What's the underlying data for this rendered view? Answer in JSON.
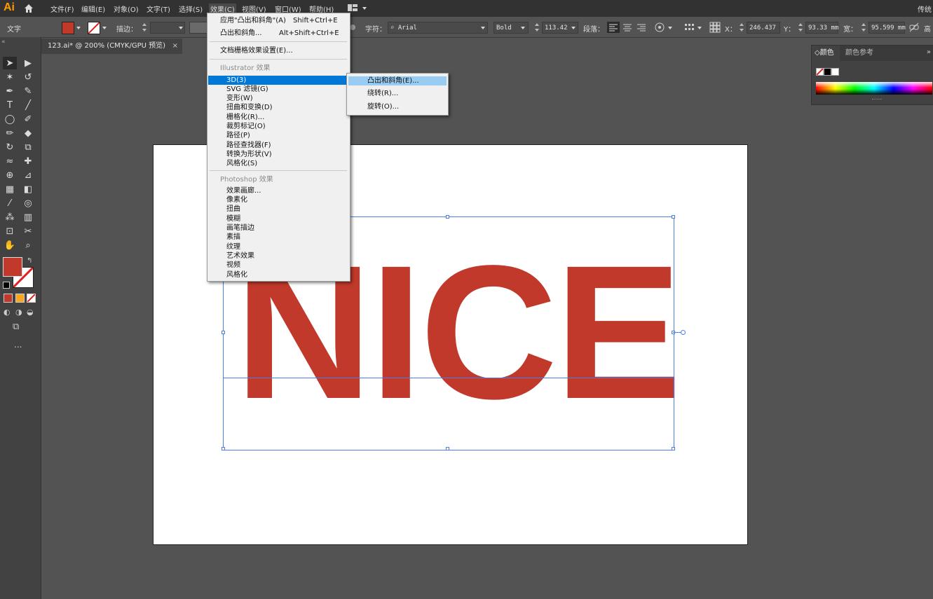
{
  "app": {
    "logo": "Ai",
    "menus": [
      "文件(F)",
      "编辑(E)",
      "对象(O)",
      "文字(T)",
      "选择(S)",
      "效果(C)",
      "视图(V)",
      "窗口(W)",
      "帮助(H)"
    ],
    "right_label": "传统"
  },
  "control_bar": {
    "type_label": "文字",
    "stroke_label": "描边：",
    "char_label": "字符：",
    "font_name": "Arial",
    "font_style": "Bold",
    "font_size": "113.42",
    "para_label": "段落：",
    "x_label": "X：",
    "x_value": "246.437",
    "y_label": "Y：",
    "y_value": "93.33 mm",
    "w_label": "宽：",
    "w_value": "95.599 mm",
    "fill_color": "#c0392b"
  },
  "document_tab": {
    "title": "123.ai* @ 200% (CMYK/GPU 预览)",
    "close": "×"
  },
  "artboard": {
    "text": "NICE",
    "text_color": "#c0392b"
  },
  "color_panel": {
    "tab_color": "颜色",
    "tab_guide": "颜色参考",
    "collapse": "»"
  },
  "effect_menu": {
    "items": [
      {
        "label": "应用\"凸出和斜角\"(A)",
        "shortcut": "Shift+Ctrl+E"
      },
      {
        "label": "凸出和斜角...",
        "shortcut": "Alt+Shift+Ctrl+E"
      },
      {
        "label": "文档栅格效果设置(E)..."
      },
      {
        "label": "Illustrator 效果"
      },
      {
        "label": "3D(3)"
      },
      {
        "label": "SVG 滤镜(G)"
      },
      {
        "label": "变形(W)"
      },
      {
        "label": "扭曲和变换(D)"
      },
      {
        "label": "栅格化(R)..."
      },
      {
        "label": "裁剪标记(O)"
      },
      {
        "label": "路径(P)"
      },
      {
        "label": "路径查找器(F)"
      },
      {
        "label": "转换为形状(V)"
      },
      {
        "label": "风格化(S)"
      },
      {
        "label": "Photoshop 效果"
      },
      {
        "label": "效果画廊..."
      },
      {
        "label": "像素化"
      },
      {
        "label": "扭曲"
      },
      {
        "label": "模糊"
      },
      {
        "label": "画笔描边"
      },
      {
        "label": "素描"
      },
      {
        "label": "纹理"
      },
      {
        "label": "艺术效果"
      },
      {
        "label": "视频"
      },
      {
        "label": "风格化"
      }
    ]
  },
  "submenu_3d": {
    "items": [
      "凸出和斜角(E)...",
      "绕转(R)...",
      "旋转(O)..."
    ]
  },
  "tools": {
    "more": "..."
  }
}
